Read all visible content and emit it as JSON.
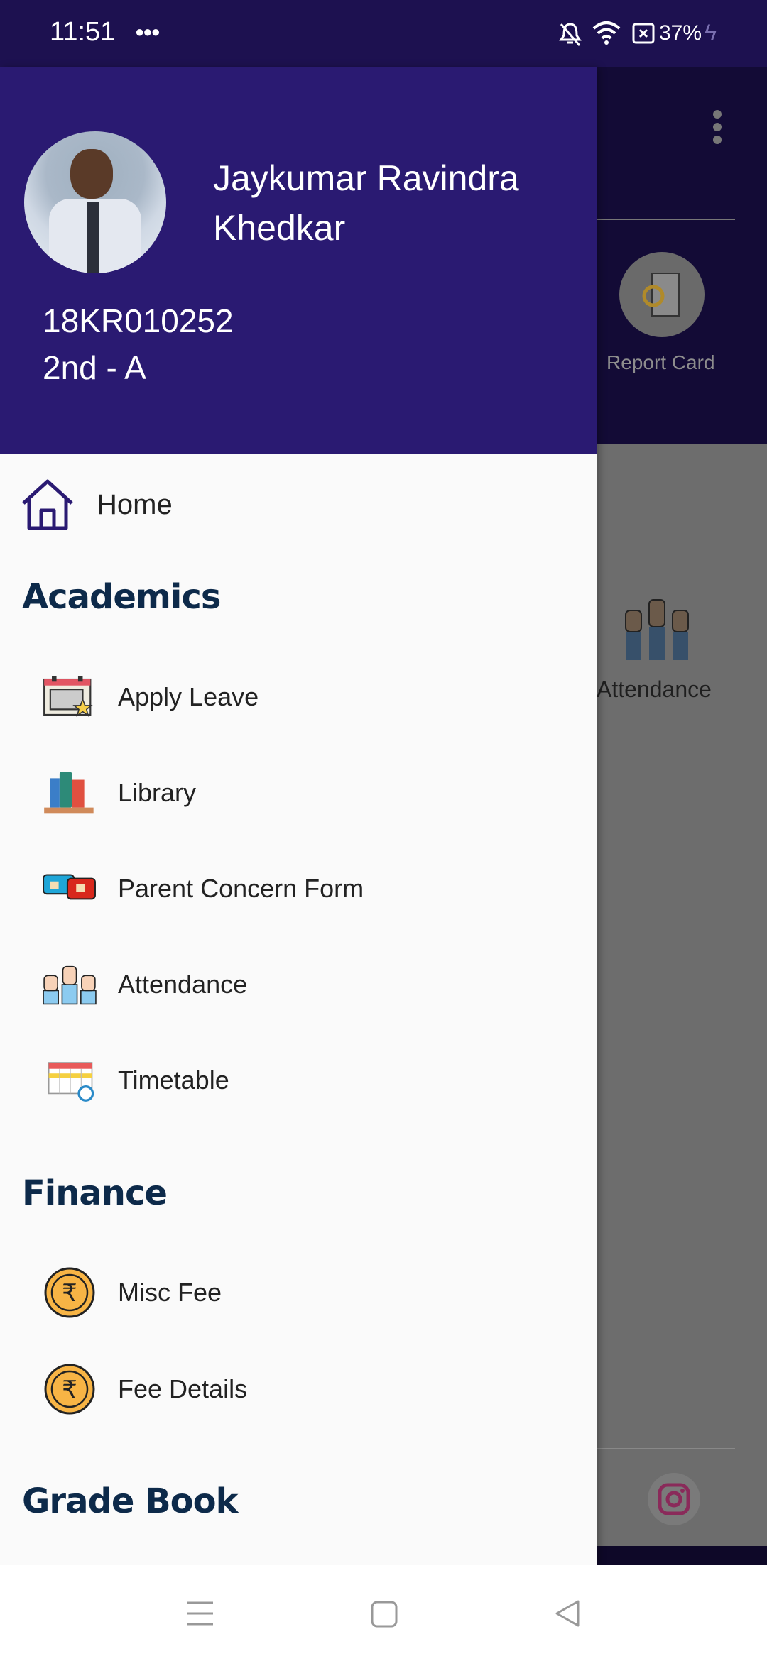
{
  "status": {
    "time": "11:51",
    "battery": "37%"
  },
  "profile": {
    "name_line1": "Jaykumar Ravindra",
    "name_line2": "Khedkar",
    "id": "18KR010252",
    "class": "2nd - A"
  },
  "menu": {
    "home": "Home",
    "sections": [
      {
        "title": "Academics",
        "items": [
          "Apply Leave",
          "Library",
          "Parent Concern Form",
          "Attendance",
          "Timetable"
        ]
      },
      {
        "title": "Finance",
        "items": [
          "Misc Fee",
          "Fee Details"
        ]
      },
      {
        "title": "Grade Book"
      }
    ]
  },
  "background": {
    "report_card": "Report Card",
    "attendance": "Attendance"
  },
  "colors": {
    "header": "#2a1a72",
    "status_bar": "#1d1150",
    "section_title": "#0d2a4a",
    "home_icon": "#2a1a72"
  }
}
